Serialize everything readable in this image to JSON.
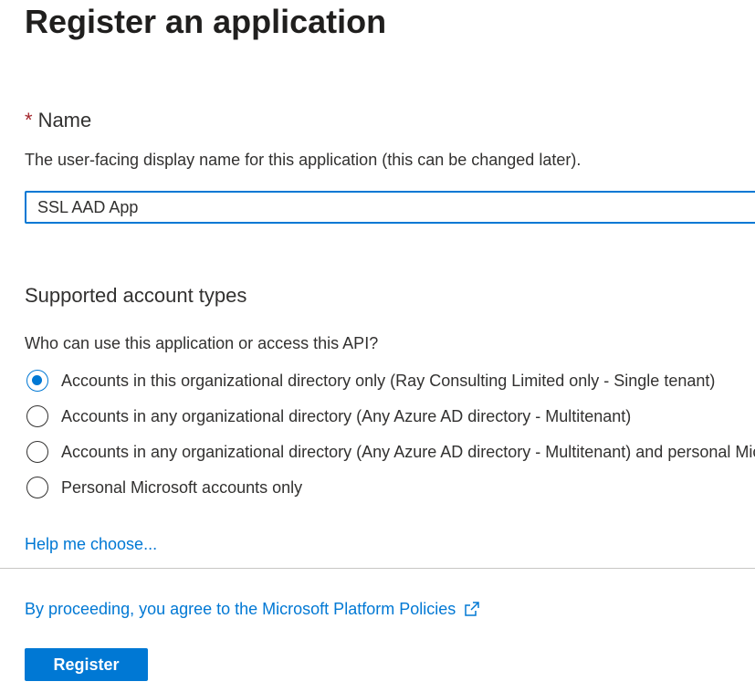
{
  "page": {
    "title": "Register an application"
  },
  "name_field": {
    "required_marker": "*",
    "label": "Name",
    "description": "The user-facing display name for this application (this can be changed later).",
    "value": "SSL AAD App"
  },
  "account_types": {
    "title": "Supported account types",
    "question": "Who can use this application or access this API?",
    "options": [
      {
        "label": "Accounts in this organizational directory only (Ray Consulting Limited only - Single tenant)",
        "selected": true
      },
      {
        "label": "Accounts in any organizational directory (Any Azure AD directory - Multitenant)",
        "selected": false
      },
      {
        "label": "Accounts in any organizational directory (Any Azure AD directory - Multitenant) and personal Microsoft accounts (e.g. Skype, Xbox)",
        "selected": false
      },
      {
        "label": "Personal Microsoft accounts only",
        "selected": false
      }
    ],
    "help_link": "Help me choose..."
  },
  "footer": {
    "policy_text": "By proceeding, you agree to the Microsoft Platform Policies",
    "policy_icon": "external-link-icon",
    "register_label": "Register"
  },
  "colors": {
    "accent": "#0078d4",
    "required": "#a4262c",
    "text": "#323130"
  }
}
